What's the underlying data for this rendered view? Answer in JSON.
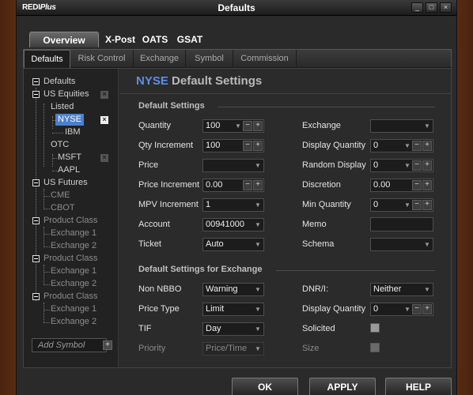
{
  "window": {
    "logo_red": "REDI",
    "logo_plus": "Plus",
    "title": "Defaults",
    "controls": [
      "_",
      "□",
      "×"
    ]
  },
  "main_tabs": [
    "Overview",
    "X-Post",
    "OATS",
    "GSAT"
  ],
  "sub_tabs": [
    "Defaults",
    "Risk Control",
    "Exchange",
    "Symbol",
    "Commission"
  ],
  "tree": {
    "defaults": "Defaults",
    "us_equities": "US Equities",
    "listed": "Listed",
    "nyse": "NYSE",
    "ibm": "IBM",
    "otc": "OTC",
    "msft": "MSFT",
    "aapl": "AAPL",
    "us_futures": "US Futures",
    "cme": "CME",
    "cbot": "CBOT",
    "product_class": "Product Class",
    "exchange_1": "Exchange 1",
    "exchange_2": "Exchange 2",
    "add_symbol": "Add Symbol",
    "add_symbol_plus": "+"
  },
  "panel": {
    "title_exchange": "NYSE",
    "title_rest": "Default Settings",
    "section1": "Default Settings",
    "section2": "Default Settings for Exchange",
    "fields": {
      "quantity_label": "Quantity",
      "quantity_value": "100",
      "qty_increment_label": "Qty Increment",
      "qty_increment_value": "100",
      "price_label": "Price",
      "price_value": "",
      "price_increment_label": "Price Increment",
      "price_increment_value": "0.00",
      "mpv_increment_label": "MPV Increment",
      "mpv_increment_value": "1",
      "account_label": "Account",
      "account_value": "00941000",
      "ticket_label": "Ticket",
      "ticket_value": "Auto",
      "exchange_label": "Exchange",
      "exchange_value": "",
      "display_quantity_label": "Display Quantity",
      "display_quantity_value": "0",
      "random_display_label": "Random Display",
      "random_display_value": "0",
      "discretion_label": "Discretion",
      "discretion_value": "0.00",
      "min_quantity_label": "Min Quantity",
      "min_quantity_value": "0",
      "memo_label": "Memo",
      "memo_value": "",
      "schema_label": "Schema",
      "schema_value": "",
      "non_nbbo_label": "Non NBBO",
      "non_nbbo_value": "Warning",
      "price_type_label": "Price Type",
      "price_type_value": "Limit",
      "tif_label": "TIF",
      "tif_value": "Day",
      "priority_label": "Priority",
      "priority_value": "Price/Time",
      "dnr_label": "DNR/I:",
      "dnr_value": "Neither",
      "ex_display_quantity_label": "Display Quantity",
      "ex_display_quantity_value": "0",
      "solicited_label": "Solicited",
      "size_label": "Size"
    }
  },
  "buttons": {
    "ok": "OK",
    "apply": "APPLY",
    "help": "HELP"
  },
  "colors": {
    "accent": "#5e8fe0",
    "selection": "#4a7fd0",
    "background": "#2b2b2b"
  }
}
